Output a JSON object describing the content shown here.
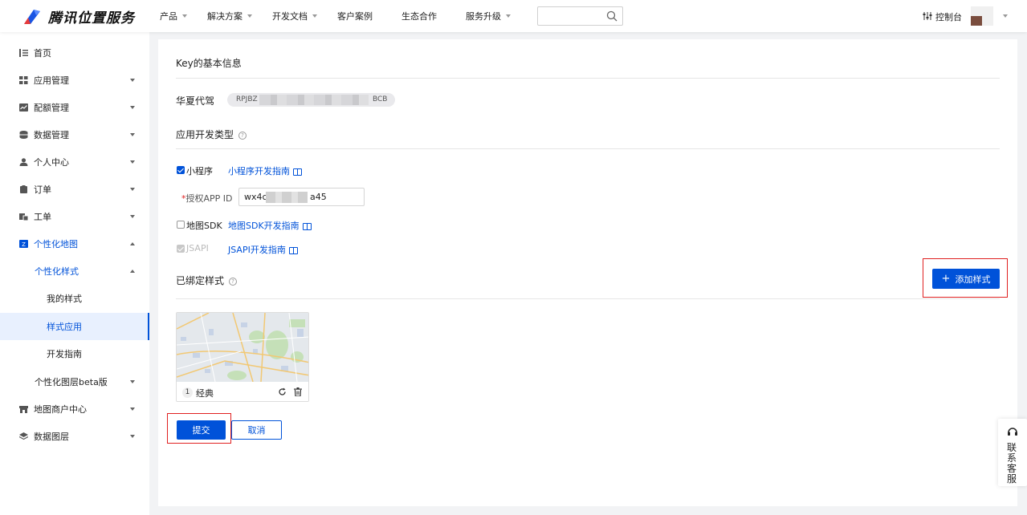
{
  "brand": {
    "name": "腾讯位置服务"
  },
  "nav": [
    {
      "label": "产品",
      "caret": true
    },
    {
      "label": "解决方案",
      "caret": true
    },
    {
      "label": "开发文档",
      "caret": true
    },
    {
      "label": "客户案例",
      "caret": false
    },
    {
      "label": "生态合作",
      "caret": false
    },
    {
      "label": "服务升级",
      "caret": true
    }
  ],
  "search": {
    "placeholder": "",
    "value": ""
  },
  "console": {
    "label": "控制台"
  },
  "sidebar": {
    "items": [
      {
        "label": "首页",
        "icon": "home-list-icon"
      },
      {
        "label": "应用管理",
        "icon": "grid-icon"
      },
      {
        "label": "配额管理",
        "icon": "quota-icon"
      },
      {
        "label": "数据管理",
        "icon": "database-icon"
      },
      {
        "label": "个人中心",
        "icon": "user-icon"
      },
      {
        "label": "订单",
        "icon": "order-icon"
      },
      {
        "label": "工单",
        "icon": "ticket-icon"
      },
      {
        "label": "个性化地图",
        "icon": "custom-map-icon"
      },
      {
        "label": "个性化样式"
      },
      {
        "label": "我的样式"
      },
      {
        "label": "样式应用"
      },
      {
        "label": "开发指南"
      },
      {
        "label": "个性化图层beta版"
      },
      {
        "label": "地图商户中心",
        "icon": "shop-icon"
      },
      {
        "label": "数据图层",
        "icon": "layers-icon"
      }
    ]
  },
  "main": {
    "section_key_info": "Key的基本信息",
    "app_name": "华夏代驾",
    "key_prefix": "RPJBZ",
    "key_suffix": "BCB",
    "section_app_type": "应用开发类型",
    "miniprogram": {
      "label": "小程序",
      "checked": true,
      "guide": "小程序开发指南"
    },
    "appid": {
      "label": "授权APP ID",
      "required_mark": "*",
      "value_prefix": "wx4c",
      "value_suffix": "a45"
    },
    "mapsdk": {
      "label": "地图SDK",
      "checked": false,
      "guide": "地图SDK开发指南"
    },
    "jsapi": {
      "label": "JSAPI",
      "checked": true,
      "disabled": true,
      "guide": "JSAPI开发指南"
    },
    "section_bound": "已绑定样式",
    "add_style_label": "添加样式",
    "add_plus": "+",
    "style_card": {
      "index": "1",
      "name": "经典"
    },
    "submit_label": "提交",
    "cancel_label": "取消",
    "help_mark": "?"
  },
  "customer_service": {
    "label": "联系客服"
  },
  "colors": {
    "primary": "#0052d9",
    "highlight_box": "#e02020"
  }
}
